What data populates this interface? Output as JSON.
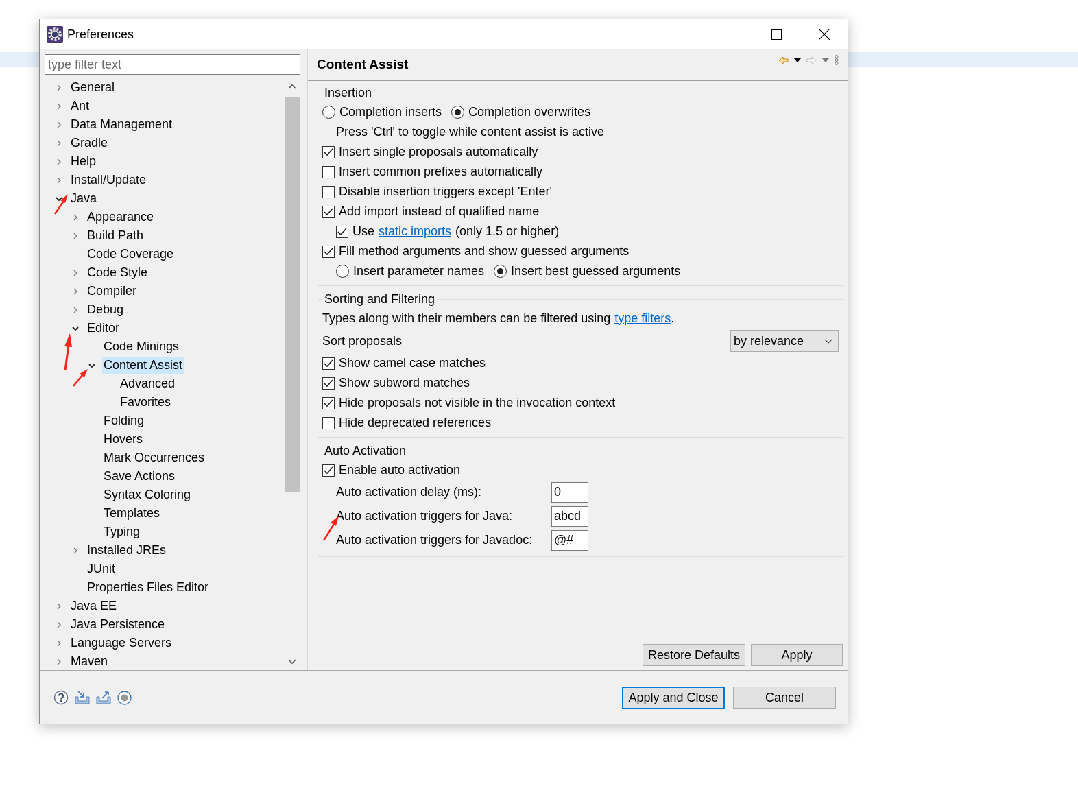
{
  "window": {
    "title": "Preferences"
  },
  "filter": {
    "placeholder": "type filter text"
  },
  "tree": [
    {
      "label": "General",
      "expanded": false,
      "selected": false
    },
    {
      "label": "Ant",
      "expanded": false,
      "selected": false
    },
    {
      "label": "Data Management",
      "expanded": false,
      "selected": false
    },
    {
      "label": "Gradle",
      "expanded": false,
      "selected": false
    },
    {
      "label": "Help",
      "expanded": false,
      "selected": false
    },
    {
      "label": "Install/Update",
      "expanded": false,
      "selected": false
    },
    {
      "label": "Java",
      "expanded": true,
      "selected": false,
      "children": [
        {
          "label": "Appearance",
          "expanded": false,
          "selected": false
        },
        {
          "label": "Build Path",
          "expanded": false,
          "selected": false
        },
        {
          "label": "Code Coverage",
          "selected": false
        },
        {
          "label": "Code Style",
          "expanded": false,
          "selected": false
        },
        {
          "label": "Compiler",
          "expanded": false,
          "selected": false
        },
        {
          "label": "Debug",
          "expanded": false,
          "selected": false
        },
        {
          "label": "Editor",
          "expanded": true,
          "selected": false,
          "children": [
            {
              "label": "Code Minings",
              "selected": false
            },
            {
              "label": "Content Assist",
              "expanded": true,
              "selected": true,
              "children": [
                {
                  "label": "Advanced",
                  "selected": false
                },
                {
                  "label": "Favorites",
                  "selected": false
                }
              ]
            },
            {
              "label": "Folding",
              "selected": false
            },
            {
              "label": "Hovers",
              "selected": false
            },
            {
              "label": "Mark Occurrences",
              "selected": false
            },
            {
              "label": "Save Actions",
              "selected": false
            },
            {
              "label": "Syntax Coloring",
              "selected": false
            },
            {
              "label": "Templates",
              "selected": false
            },
            {
              "label": "Typing",
              "selected": false
            }
          ]
        },
        {
          "label": "Installed JREs",
          "expanded": false,
          "selected": false
        },
        {
          "label": "JUnit",
          "selected": false
        },
        {
          "label": "Properties Files Editor",
          "selected": false
        }
      ]
    },
    {
      "label": "Java EE",
      "expanded": false,
      "selected": false
    },
    {
      "label": "Java Persistence",
      "expanded": false,
      "selected": false
    },
    {
      "label": "Language Servers",
      "expanded": false,
      "selected": false
    },
    {
      "label": "Maven",
      "expanded": false,
      "selected": false
    }
  ],
  "page": {
    "title": "Content Assist",
    "groups": [
      {
        "title": "Insertion",
        "rows": [
          {
            "kind": "radios",
            "options": [
              {
                "label": "Completion inserts",
                "selected": false
              },
              {
                "label": "Completion overwrites",
                "selected": true
              }
            ]
          },
          {
            "kind": "note",
            "text": "Press 'Ctrl' to toggle while content assist is active"
          },
          {
            "kind": "checkbox",
            "label": "Insert single proposals automatically",
            "checked": true
          },
          {
            "kind": "checkbox",
            "label": "Insert common prefixes automatically",
            "checked": false
          },
          {
            "kind": "checkbox",
            "label": "Disable insertion triggers except 'Enter'",
            "checked": false
          },
          {
            "kind": "checkbox",
            "label": "Add import instead of qualified name",
            "checked": true,
            "children": [
              {
                "kind": "checkbox",
                "label": "Use",
                "link": "static imports",
                "suffix": "(only 1.5 or higher)",
                "checked": true
              }
            ]
          },
          {
            "kind": "checkbox",
            "label": "Fill method arguments and show guessed arguments",
            "checked": true,
            "children": [
              {
                "kind": "radios",
                "options": [
                  {
                    "label": "Insert parameter names",
                    "selected": false
                  },
                  {
                    "label": "Insert best guessed arguments",
                    "selected": true
                  }
                ]
              }
            ]
          }
        ]
      },
      {
        "title": "Sorting and Filtering",
        "rows": [
          {
            "kind": "note",
            "text": "Types along with their members can be filtered using",
            "link": "type filters",
            "suffix": "."
          },
          {
            "kind": "select",
            "label": "Sort proposals",
            "value": "by relevance"
          },
          {
            "kind": "checkbox",
            "label": "Show camel case matches",
            "checked": true
          },
          {
            "kind": "checkbox",
            "label": "Show subword matches",
            "checked": true
          },
          {
            "kind": "checkbox",
            "label": "Hide proposals not visible in the invocation context",
            "checked": true
          },
          {
            "kind": "checkbox",
            "label": "Hide deprecated references",
            "checked": false
          }
        ]
      },
      {
        "title": "Auto Activation",
        "rows": [
          {
            "kind": "checkbox",
            "label": "Enable auto activation",
            "checked": true
          },
          {
            "kind": "field",
            "label": "Auto activation delay (ms):",
            "value": "0"
          },
          {
            "kind": "field",
            "label": "Auto activation triggers for Java:",
            "value": "abcd"
          },
          {
            "kind": "field",
            "label": "Auto activation triggers for Javadoc:",
            "value": "@#"
          }
        ]
      }
    ],
    "buttons": [
      "Restore Defaults",
      "Apply"
    ]
  },
  "footer_buttons": [
    {
      "label": "Apply and Close",
      "default": true
    },
    {
      "label": "Cancel",
      "default": false
    }
  ]
}
